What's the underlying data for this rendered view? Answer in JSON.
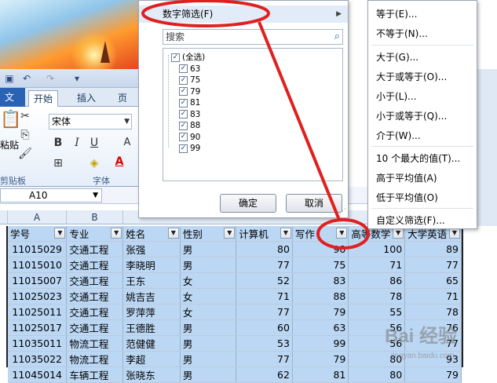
{
  "colors": {
    "accent": "#e02020",
    "selection": "#bcd7f3",
    "file_tab": "#2a63b4"
  },
  "ribbon": {
    "tabs": {
      "file": "文件",
      "home": "开始",
      "insert": "插入",
      "page": "页面"
    },
    "font_name": "宋体",
    "bold": "B",
    "italic": "I",
    "underline": "U",
    "font_color_letter": "A",
    "group_clipboard": "剪贴板",
    "group_font": "字体",
    "paste_label": "粘贴"
  },
  "namebox": {
    "value": "A10"
  },
  "columns": [
    "A",
    "B"
  ],
  "filter_panel": {
    "number_filter": "数字筛选(F)",
    "search_placeholder": "搜索",
    "values": [
      "(全选)",
      "63",
      "75",
      "79",
      "81",
      "83",
      "88",
      "90",
      "99"
    ],
    "ok": "确定",
    "cancel": "取消"
  },
  "submenu": {
    "items": [
      "等于(E)...",
      "不等于(N)...",
      "大于(G)...",
      "大于或等于(O)...",
      "小于(L)...",
      "小于或等于(Q)...",
      "介于(W)...",
      "10 个最大的值(T)...",
      "高于平均值(A)",
      "低于平均值(O)",
      "自定义筛选(F)..."
    ]
  },
  "table": {
    "headers": [
      "学号",
      "专业",
      "姓名",
      "性别",
      "计算机",
      "写作",
      "高等数学",
      "大学英语"
    ],
    "rows": [
      [
        "11015029",
        "交通工程",
        "张强",
        "男",
        "80",
        "90",
        "100",
        "89"
      ],
      [
        "11015010",
        "交通工程",
        "李晓明",
        "男",
        "77",
        "75",
        "71",
        "77"
      ],
      [
        "11015007",
        "交通工程",
        "王东",
        "女",
        "52",
        "83",
        "86",
        "65"
      ],
      [
        "11025023",
        "交通工程",
        "姚吉吉",
        "女",
        "71",
        "88",
        "78",
        "71"
      ],
      [
        "11025011",
        "交通工程",
        "罗萍萍",
        "女",
        "77",
        "79",
        "55",
        "78"
      ],
      [
        "11025017",
        "交通工程",
        "王德胜",
        "男",
        "60",
        "63",
        "56",
        "76"
      ],
      [
        "11035011",
        "物流工程",
        "范健健",
        "男",
        "53",
        "99",
        "56",
        "77"
      ],
      [
        "11035022",
        "物流工程",
        "李超",
        "男",
        "77",
        "79",
        "80",
        "93"
      ],
      [
        "11045014",
        "车辆工程",
        "张晓东",
        "男",
        "62",
        "81",
        "80",
        "79"
      ]
    ]
  },
  "watermark": {
    "text": "Bai 经验",
    "url_text": "jingyan.baidu.com"
  }
}
